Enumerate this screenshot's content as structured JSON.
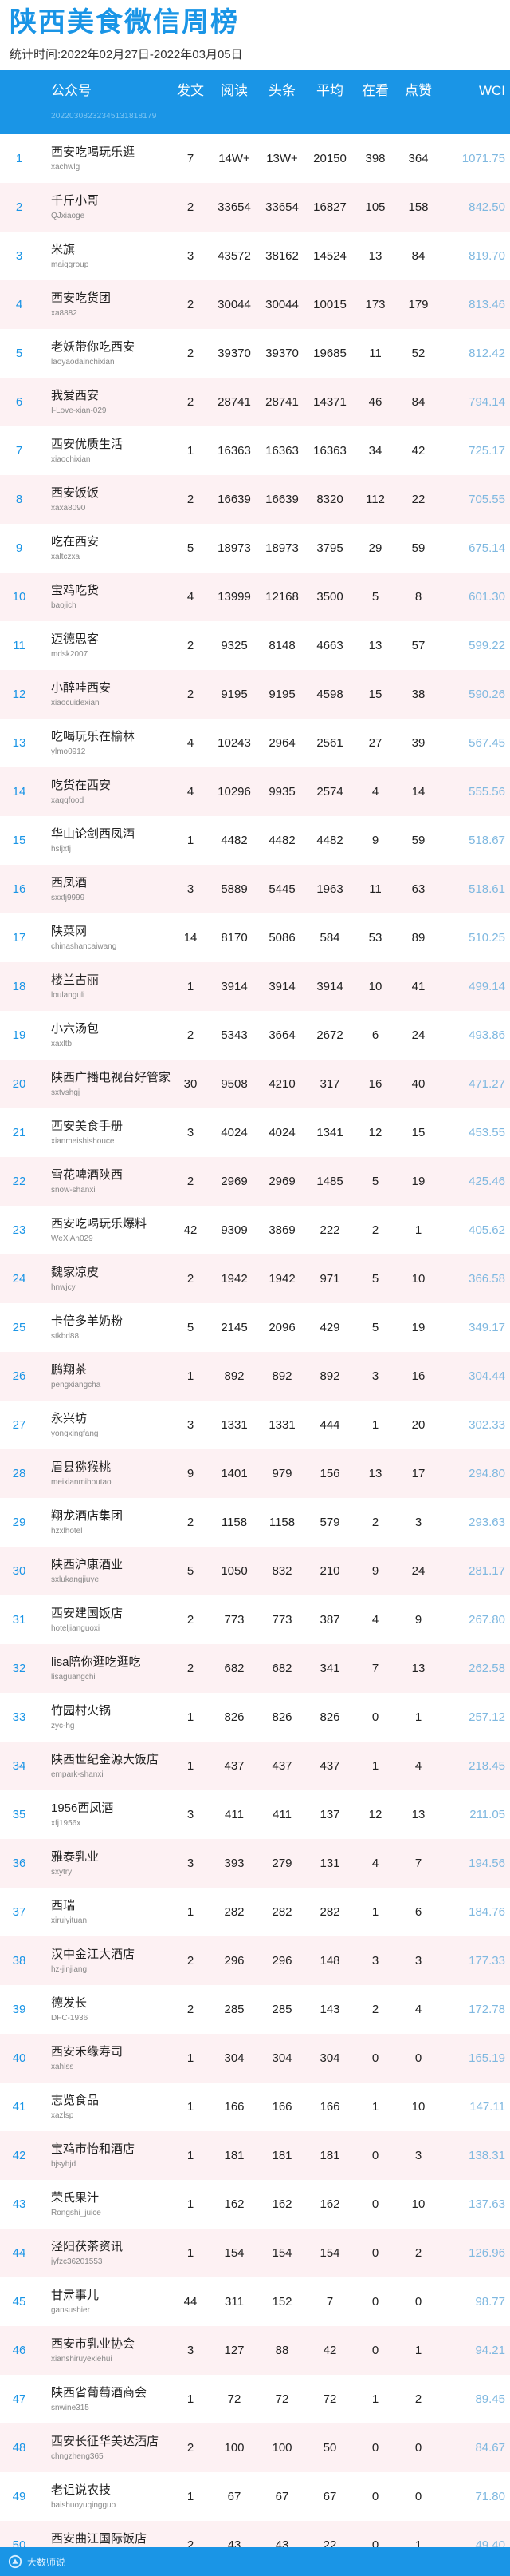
{
  "header": {
    "title": "陕西美食微信周榜",
    "period": "统计时间:2022年02月27日-2022年03月05日"
  },
  "table": {
    "columns": {
      "account": "公众号",
      "posts": "发文",
      "reads": "阅读",
      "headline": "头条",
      "average": "平均",
      "looking": "在看",
      "likes": "点赞",
      "wci": "WCI"
    },
    "subheader": "20220308232345131818179",
    "rows": [
      {
        "rank": "1",
        "name": "西安吃喝玩乐逛",
        "id": "xachwlg",
        "posts": "7",
        "reads": "14W+",
        "head": "13W+",
        "avg": "20150",
        "look": "398",
        "like": "364",
        "wci": "1071.75"
      },
      {
        "rank": "2",
        "name": "千斤小哥",
        "id": "QJxiaoge",
        "posts": "2",
        "reads": "33654",
        "head": "33654",
        "avg": "16827",
        "look": "105",
        "like": "158",
        "wci": "842.50"
      },
      {
        "rank": "3",
        "name": "米旗",
        "id": "maiqgroup",
        "posts": "3",
        "reads": "43572",
        "head": "38162",
        "avg": "14524",
        "look": "13",
        "like": "84",
        "wci": "819.70"
      },
      {
        "rank": "4",
        "name": "西安吃货团",
        "id": "xa8882",
        "posts": "2",
        "reads": "30044",
        "head": "30044",
        "avg": "10015",
        "look": "173",
        "like": "179",
        "wci": "813.46"
      },
      {
        "rank": "5",
        "name": "老妖带你吃西安",
        "id": "laoyaodainchixian",
        "posts": "2",
        "reads": "39370",
        "head": "39370",
        "avg": "19685",
        "look": "11",
        "like": "52",
        "wci": "812.42"
      },
      {
        "rank": "6",
        "name": "我爱西安",
        "id": "I-Love-xian-029",
        "posts": "2",
        "reads": "28741",
        "head": "28741",
        "avg": "14371",
        "look": "46",
        "like": "84",
        "wci": "794.14"
      },
      {
        "rank": "7",
        "name": "西安优质生活",
        "id": "xiaochixian",
        "posts": "1",
        "reads": "16363",
        "head": "16363",
        "avg": "16363",
        "look": "34",
        "like": "42",
        "wci": "725.17"
      },
      {
        "rank": "8",
        "name": "西安饭饭",
        "id": "xaxa8090",
        "posts": "2",
        "reads": "16639",
        "head": "16639",
        "avg": "8320",
        "look": "112",
        "like": "22",
        "wci": "705.55"
      },
      {
        "rank": "9",
        "name": "吃在西安",
        "id": "xaltczxa",
        "posts": "5",
        "reads": "18973",
        "head": "18973",
        "avg": "3795",
        "look": "29",
        "like": "59",
        "wci": "675.14"
      },
      {
        "rank": "10",
        "name": "宝鸡吃货",
        "id": "baojich",
        "posts": "4",
        "reads": "13999",
        "head": "12168",
        "avg": "3500",
        "look": "5",
        "like": "8",
        "wci": "601.30"
      },
      {
        "rank": "11",
        "name": "迈德思客",
        "id": "mdsk2007",
        "posts": "2",
        "reads": "9325",
        "head": "8148",
        "avg": "4663",
        "look": "13",
        "like": "57",
        "wci": "599.22"
      },
      {
        "rank": "12",
        "name": "小醉哇西安",
        "id": "xiaocuidexian",
        "posts": "2",
        "reads": "9195",
        "head": "9195",
        "avg": "4598",
        "look": "15",
        "like": "38",
        "wci": "590.26"
      },
      {
        "rank": "13",
        "name": "吃喝玩乐在榆林",
        "id": "ylmo0912",
        "posts": "4",
        "reads": "10243",
        "head": "2964",
        "avg": "2561",
        "look": "27",
        "like": "39",
        "wci": "567.45"
      },
      {
        "rank": "14",
        "name": "吃货在西安",
        "id": "xaqqfood",
        "posts": "4",
        "reads": "10296",
        "head": "9935",
        "avg": "2574",
        "look": "4",
        "like": "14",
        "wci": "555.56"
      },
      {
        "rank": "15",
        "name": "华山论剑西凤酒",
        "id": "hsljxfj",
        "posts": "1",
        "reads": "4482",
        "head": "4482",
        "avg": "4482",
        "look": "9",
        "like": "59",
        "wci": "518.67"
      },
      {
        "rank": "16",
        "name": "西凤酒",
        "id": "sxxfj9999",
        "posts": "3",
        "reads": "5889",
        "head": "5445",
        "avg": "1963",
        "look": "11",
        "like": "63",
        "wci": "518.61"
      },
      {
        "rank": "17",
        "name": "陕菜网",
        "id": "chinashancaiwang",
        "posts": "14",
        "reads": "8170",
        "head": "5086",
        "avg": "584",
        "look": "53",
        "like": "89",
        "wci": "510.25"
      },
      {
        "rank": "18",
        "name": "楼兰古丽",
        "id": "loulanguli",
        "posts": "1",
        "reads": "3914",
        "head": "3914",
        "avg": "3914",
        "look": "10",
        "like": "41",
        "wci": "499.14"
      },
      {
        "rank": "19",
        "name": "小六汤包",
        "id": "xaxltb",
        "posts": "2",
        "reads": "5343",
        "head": "3664",
        "avg": "2672",
        "look": "6",
        "like": "24",
        "wci": "493.86"
      },
      {
        "rank": "20",
        "name": "陕西广播电视台好管家",
        "id": "sxtvshgj",
        "posts": "30",
        "reads": "9508",
        "head": "4210",
        "avg": "317",
        "look": "16",
        "like": "40",
        "wci": "471.27"
      },
      {
        "rank": "21",
        "name": "西安美食手册",
        "id": "xianmeishishouce",
        "posts": "3",
        "reads": "4024",
        "head": "4024",
        "avg": "1341",
        "look": "12",
        "like": "15",
        "wci": "453.55"
      },
      {
        "rank": "22",
        "name": "雪花啤酒陕西",
        "id": "snow-shanxi",
        "posts": "2",
        "reads": "2969",
        "head": "2969",
        "avg": "1485",
        "look": "5",
        "like": "19",
        "wci": "425.46"
      },
      {
        "rank": "23",
        "name": "西安吃喝玩乐爆料",
        "id": "WeXiAn029",
        "posts": "42",
        "reads": "9309",
        "head": "3869",
        "avg": "222",
        "look": "2",
        "like": "1",
        "wci": "405.62"
      },
      {
        "rank": "24",
        "name": "魏家凉皮",
        "id": "hnwjcy",
        "posts": "2",
        "reads": "1942",
        "head": "1942",
        "avg": "971",
        "look": "5",
        "like": "10",
        "wci": "366.58"
      },
      {
        "rank": "25",
        "name": "卡倍多羊奶粉",
        "id": "stkbd88",
        "posts": "5",
        "reads": "2145",
        "head": "2096",
        "avg": "429",
        "look": "5",
        "like": "19",
        "wci": "349.17"
      },
      {
        "rank": "26",
        "name": "鹏翔茶",
        "id": "pengxiangcha",
        "posts": "1",
        "reads": "892",
        "head": "892",
        "avg": "892",
        "look": "3",
        "like": "16",
        "wci": "304.44"
      },
      {
        "rank": "27",
        "name": "永兴坊",
        "id": "yongxingfang",
        "posts": "3",
        "reads": "1331",
        "head": "1331",
        "avg": "444",
        "look": "1",
        "like": "20",
        "wci": "302.33"
      },
      {
        "rank": "28",
        "name": "眉县猕猴桃",
        "id": "meixianmihoutao",
        "posts": "9",
        "reads": "1401",
        "head": "979",
        "avg": "156",
        "look": "13",
        "like": "17",
        "wci": "294.80"
      },
      {
        "rank": "29",
        "name": "翔龙酒店集团",
        "id": "hzxlhotel",
        "posts": "2",
        "reads": "1158",
        "head": "1158",
        "avg": "579",
        "look": "2",
        "like": "3",
        "wci": "293.63"
      },
      {
        "rank": "30",
        "name": "陕西沪康酒业",
        "id": "sxlukangjiuye",
        "posts": "5",
        "reads": "1050",
        "head": "832",
        "avg": "210",
        "look": "9",
        "like": "24",
        "wci": "281.17"
      },
      {
        "rank": "31",
        "name": "西安建国饭店",
        "id": "hoteljianguoxi",
        "posts": "2",
        "reads": "773",
        "head": "773",
        "avg": "387",
        "look": "4",
        "like": "9",
        "wci": "267.80"
      },
      {
        "rank": "32",
        "name": "lisa陪你逛吃逛吃",
        "id": "lisaguangchi",
        "posts": "2",
        "reads": "682",
        "head": "682",
        "avg": "341",
        "look": "7",
        "like": "13",
        "wci": "262.58"
      },
      {
        "rank": "33",
        "name": "竹园村火锅",
        "id": "zyc-hg",
        "posts": "1",
        "reads": "826",
        "head": "826",
        "avg": "826",
        "look": "0",
        "like": "1",
        "wci": "257.12"
      },
      {
        "rank": "34",
        "name": "陕西世纪金源大饭店",
        "id": "empark-shanxi",
        "posts": "1",
        "reads": "437",
        "head": "437",
        "avg": "437",
        "look": "1",
        "like": "4",
        "wci": "218.45"
      },
      {
        "rank": "35",
        "name": "1956西凤酒",
        "id": "xfj1956x",
        "posts": "3",
        "reads": "411",
        "head": "411",
        "avg": "137",
        "look": "12",
        "like": "13",
        "wci": "211.05"
      },
      {
        "rank": "36",
        "name": "雅泰乳业",
        "id": "sxytry",
        "posts": "3",
        "reads": "393",
        "head": "279",
        "avg": "131",
        "look": "4",
        "like": "7",
        "wci": "194.56"
      },
      {
        "rank": "37",
        "name": "西瑞",
        "id": "xiruiyituan",
        "posts": "1",
        "reads": "282",
        "head": "282",
        "avg": "282",
        "look": "1",
        "like": "6",
        "wci": "184.76"
      },
      {
        "rank": "38",
        "name": "汉中金江大酒店",
        "id": "hz-jinjiang",
        "posts": "2",
        "reads": "296",
        "head": "296",
        "avg": "148",
        "look": "3",
        "like": "3",
        "wci": "177.33"
      },
      {
        "rank": "39",
        "name": "德发长",
        "id": "DFC-1936",
        "posts": "2",
        "reads": "285",
        "head": "285",
        "avg": "143",
        "look": "2",
        "like": "4",
        "wci": "172.78"
      },
      {
        "rank": "40",
        "name": "西安禾缘寿司",
        "id": "xahlss",
        "posts": "1",
        "reads": "304",
        "head": "304",
        "avg": "304",
        "look": "0",
        "like": "0",
        "wci": "165.19"
      },
      {
        "rank": "41",
        "name": "志览食品",
        "id": "xazlsp",
        "posts": "1",
        "reads": "166",
        "head": "166",
        "avg": "166",
        "look": "1",
        "like": "10",
        "wci": "147.11"
      },
      {
        "rank": "42",
        "name": "宝鸡市怡和酒店",
        "id": "bjsyhjd",
        "posts": "1",
        "reads": "181",
        "head": "181",
        "avg": "181",
        "look": "0",
        "like": "3",
        "wci": "138.31"
      },
      {
        "rank": "43",
        "name": "荣氏果汁",
        "id": "Rongshi_juice",
        "posts": "1",
        "reads": "162",
        "head": "162",
        "avg": "162",
        "look": "0",
        "like": "10",
        "wci": "137.63"
      },
      {
        "rank": "44",
        "name": "泾阳茯茶资讯",
        "id": "jyfzc36201553",
        "posts": "1",
        "reads": "154",
        "head": "154",
        "avg": "154",
        "look": "0",
        "like": "2",
        "wci": "126.96"
      },
      {
        "rank": "45",
        "name": "甘肃事儿",
        "id": "gansushier",
        "posts": "44",
        "reads": "311",
        "head": "152",
        "avg": "7",
        "look": "0",
        "like": "0",
        "wci": "98.77"
      },
      {
        "rank": "46",
        "name": "西安市乳业协会",
        "id": "xianshiruyexiehui",
        "posts": "3",
        "reads": "127",
        "head": "88",
        "avg": "42",
        "look": "0",
        "like": "1",
        "wci": "94.21"
      },
      {
        "rank": "47",
        "name": "陕西省葡萄酒商会",
        "id": "snwine315",
        "posts": "1",
        "reads": "72",
        "head": "72",
        "avg": "72",
        "look": "1",
        "like": "2",
        "wci": "89.45"
      },
      {
        "rank": "48",
        "name": "西安长征华美达酒店",
        "id": "chngzheng365",
        "posts": "2",
        "reads": "100",
        "head": "100",
        "avg": "50",
        "look": "0",
        "like": "0",
        "wci": "84.67"
      },
      {
        "rank": "49",
        "name": "老诅说农技",
        "id": "baishuoyuqingguo",
        "posts": "1",
        "reads": "67",
        "head": "67",
        "avg": "67",
        "look": "0",
        "like": "0",
        "wci": "71.80"
      },
      {
        "rank": "50",
        "name": "西安曲江国际饭店",
        "id": "qujiang68799999",
        "posts": "2",
        "reads": "43",
        "head": "43",
        "avg": "22",
        "look": "0",
        "like": "1",
        "wci": "49.40"
      }
    ]
  },
  "footer": {
    "brand": "大数师说",
    "logo_icon": "brand-logo-icon",
    "accent": "#1a95e6"
  }
}
